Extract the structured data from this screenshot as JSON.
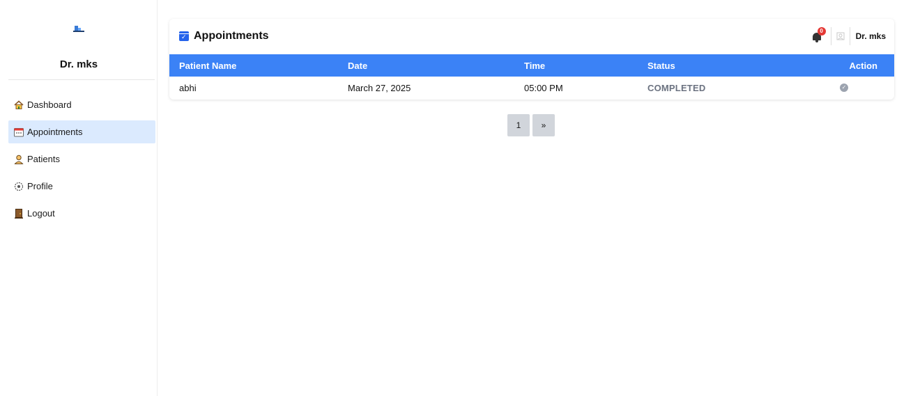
{
  "sidebar": {
    "user_name": "Dr. mks",
    "items": [
      {
        "label": "Dashboard",
        "icon": "home-icon"
      },
      {
        "label": "Appointments",
        "icon": "calendar-icon",
        "active": true
      },
      {
        "label": "Patients",
        "icon": "person-icon"
      },
      {
        "label": "Profile",
        "icon": "gear-icon"
      },
      {
        "label": "Logout",
        "icon": "door-icon"
      }
    ]
  },
  "header": {
    "title": "Appointments",
    "notification_count": "0",
    "user_name": "Dr. mks"
  },
  "table": {
    "columns": [
      "Patient Name",
      "Date",
      "Time",
      "Status",
      "Action"
    ],
    "rows": [
      {
        "patient": "abhi",
        "date": "March 27, 2025",
        "time": "05:00 PM",
        "status": "COMPLETED",
        "action_icon": "check-circle-icon"
      }
    ]
  },
  "pagination": {
    "current": "1",
    "next": "»"
  },
  "colors": {
    "accent": "#3b82f6",
    "active_nav_bg": "#dbeafe",
    "badge": "#e53935",
    "status_text": "#6b7280"
  }
}
